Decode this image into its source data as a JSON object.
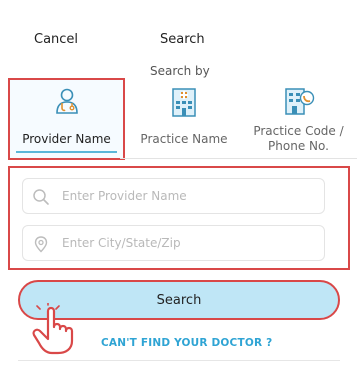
{
  "header": {
    "cancel_label": "Cancel",
    "title": "Search",
    "search_by_label": "Search by"
  },
  "tabs": [
    {
      "label": "Provider Name",
      "icon": "doctor-icon",
      "selected": true
    },
    {
      "label": "Practice Name",
      "icon": "hospital-building-icon",
      "selected": false
    },
    {
      "label": "Practice Code / Phone No.",
      "label_line1": "Practice Code /",
      "label_line2": "Phone No.",
      "icon": "building-phone-icon",
      "selected": false
    }
  ],
  "inputs": {
    "provider": {
      "placeholder": "Enter Provider Name",
      "value": "",
      "icon": "search-icon"
    },
    "location": {
      "placeholder": "Enter City/State/Zip",
      "value": "",
      "icon": "location-pin-icon"
    }
  },
  "search_button": {
    "label": "Search"
  },
  "cant_find_link": {
    "label": "CAN'T FIND YOUR DOCTOR ?"
  },
  "colors": {
    "highlight_red": "#d94848",
    "accent_blue": "#5bb6d8",
    "button_fill": "#bfe6f6",
    "link_blue": "#2fa4d4"
  }
}
